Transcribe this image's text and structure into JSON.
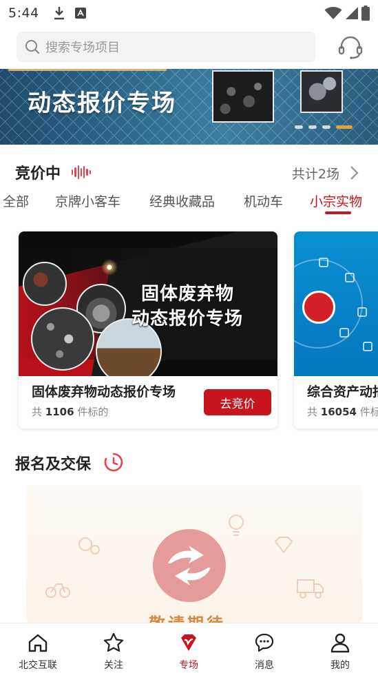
{
  "status_bar": {
    "time": "5:44"
  },
  "search": {
    "placeholder": "搜索专场项目"
  },
  "banner": {
    "title": "动态报价专场",
    "slide_count": 4,
    "active_slide": 4
  },
  "bidding": {
    "title": "竞价中",
    "count_text": "共计2场",
    "tabs": [
      {
        "label": "全部"
      },
      {
        "label": "京牌小客车"
      },
      {
        "label": "经典收藏品"
      },
      {
        "label": "机动车"
      },
      {
        "label": "小宗实物"
      }
    ],
    "active_tab": "小宗实物",
    "cards": [
      {
        "image_title_line1": "固体废弃物",
        "image_title_line2": "动态报价专场",
        "name": "固体废弃物动态报价专场",
        "meta_prefix": "共",
        "count": "1106",
        "meta_suffix": "件标的",
        "button": "去竞价"
      },
      {
        "name": "综合资产动拍",
        "meta_prefix": "共",
        "count": "16054",
        "meta_suffix": "件标的"
      }
    ]
  },
  "signup": {
    "title": "报名及交保",
    "promo_text": "敬请期待"
  },
  "bottom_nav": [
    {
      "label": "北交互联",
      "icon": "home-icon"
    },
    {
      "label": "关注",
      "icon": "star-icon"
    },
    {
      "label": "专场",
      "icon": "special-v-icon"
    },
    {
      "label": "消息",
      "icon": "message-icon"
    },
    {
      "label": "我的",
      "icon": "user-icon"
    }
  ],
  "active_nav": "专场",
  "colors": {
    "accent": "#c8151d",
    "promo_gold": "#d08c44",
    "banner_dot_active": "#e6a23c"
  }
}
